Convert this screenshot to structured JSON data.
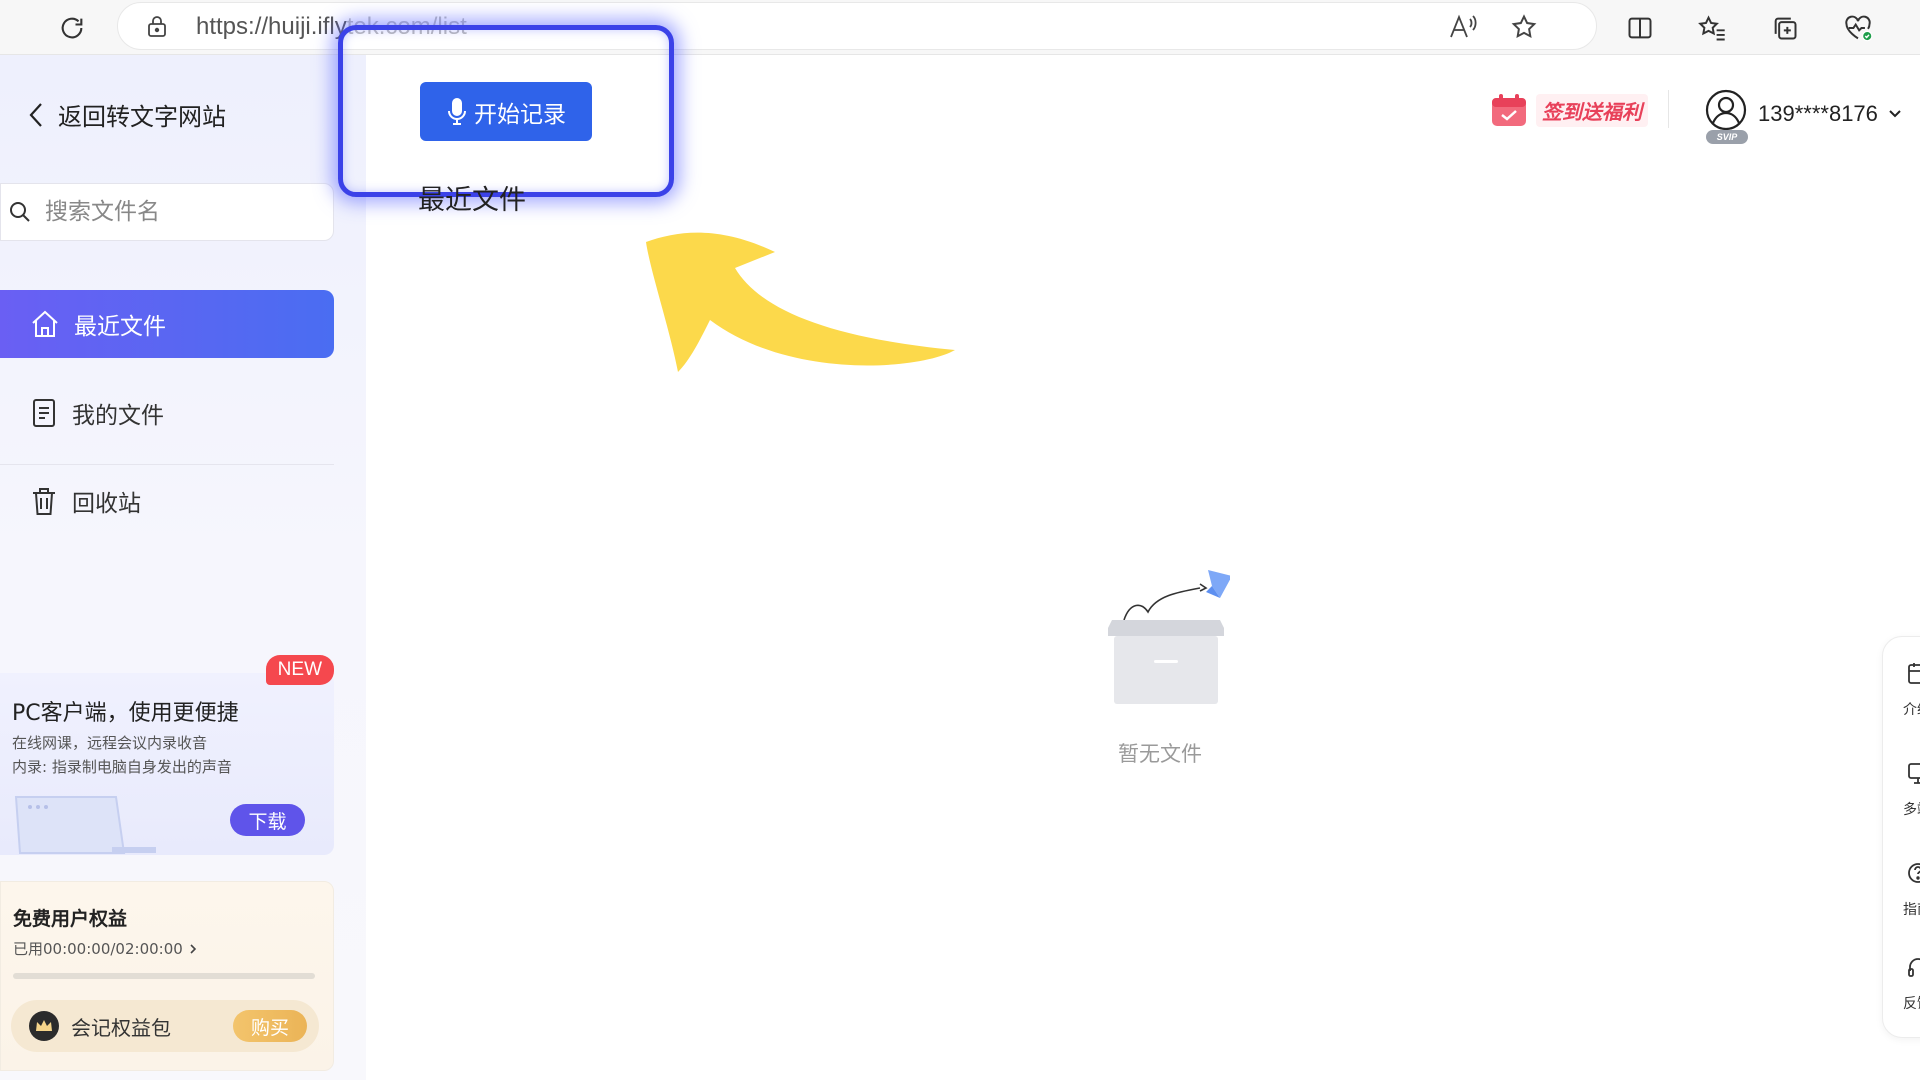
{
  "browser": {
    "url_visible": "https://huiji.ifly",
    "url_faded": "tek.com/list",
    "icons": [
      "refresh-icon",
      "lock-icon",
      "read-aloud-icon",
      "star-icon",
      "split-screen-icon",
      "favorites-icon",
      "collections-icon",
      "health-icon"
    ]
  },
  "sidebar": {
    "back_label": "返回转文字网站",
    "search_placeholder": "搜索文件名",
    "nav": [
      {
        "label": "最近文件",
        "icon": "home-icon",
        "active": true
      },
      {
        "label": "我的文件",
        "icon": "document-icon",
        "active": false
      },
      {
        "label": "回收站",
        "icon": "trash-icon",
        "active": false
      }
    ],
    "promo": {
      "badge": "NEW",
      "title": "PC客户端，使用更便捷",
      "line1": "在线网课，远程会议内录收音",
      "line2": "内录: 指录制电脑自身发出的声音",
      "download_label": "下载"
    },
    "benefits": {
      "title": "免费用户权益",
      "usage": "已用00:00:00/02:00:00",
      "usage_fraction": 0,
      "pack_label": "会记权益包",
      "buy_label": "购买"
    }
  },
  "main": {
    "start_label": "开始记录",
    "section_title": "最近文件",
    "empty_text": "暂无文件"
  },
  "header": {
    "signin_label": "签到送福利",
    "user_phone": "139****8176",
    "vip_badge": "SVIP"
  },
  "right_dock": {
    "items": [
      {
        "label": "介绍",
        "icon": "calendar-icon"
      },
      {
        "label": "多端",
        "icon": "monitor-icon"
      },
      {
        "label": "指南",
        "icon": "help-icon"
      },
      {
        "label": "反馈",
        "icon": "headset-icon"
      }
    ]
  },
  "colors": {
    "primary": "#2f63ea",
    "active_nav_start": "#6a5ff3",
    "active_nav_end": "#4a6df2",
    "highlight": "#3b42e8",
    "annotation_arrow": "#fcd94b",
    "badge_red": "#f5484e",
    "gold": "#ebb457"
  }
}
